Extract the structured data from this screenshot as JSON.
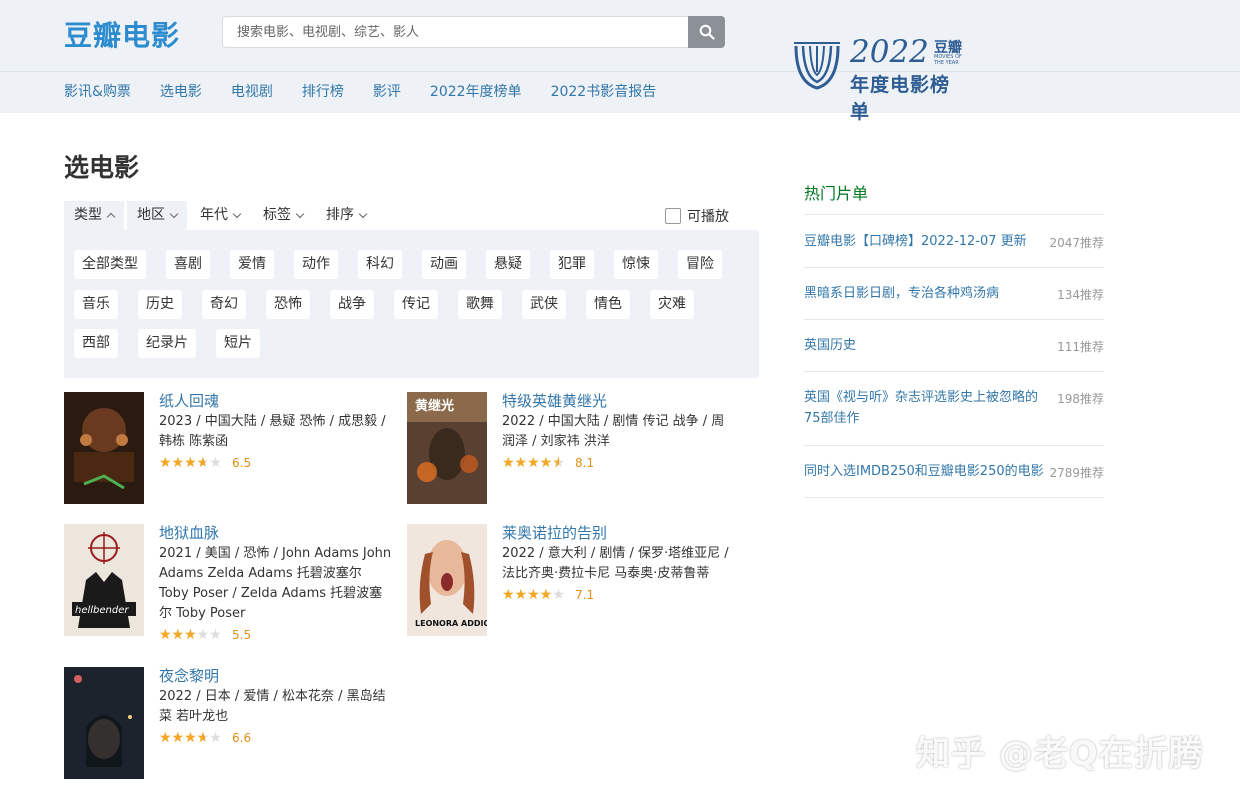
{
  "header": {
    "logo": "豆瓣电影",
    "search_placeholder": "搜索电影、电视剧、综艺、影人",
    "banner": {
      "year": "2022",
      "tag": "豆瓣",
      "sub": "MOVIES OF THE YEAR",
      "title": "年度电影榜单"
    }
  },
  "nav": [
    "影讯&购票",
    "选电影",
    "电视剧",
    "排行榜",
    "影评",
    "2022年度榜单",
    "2022书影音报告"
  ],
  "page_title": "选电影",
  "filters": {
    "items": [
      "类型",
      "地区",
      "年代",
      "标签",
      "排序"
    ],
    "playable": "可播放"
  },
  "tags": [
    "全部类型",
    "喜剧",
    "爱情",
    "动作",
    "科幻",
    "动画",
    "悬疑",
    "犯罪",
    "惊悚",
    "冒险",
    "音乐",
    "历史",
    "奇幻",
    "恐怖",
    "战争",
    "传记",
    "歌舞",
    "武侠",
    "情色",
    "灾难",
    "西部",
    "纪录片",
    "短片"
  ],
  "movies": [
    {
      "title": "纸人回魂",
      "meta": "2023 / 中国大陆 / 悬疑 恐怖 / 成思毅 / 韩栋 陈紫函",
      "rating": "6.5",
      "stars": 0.65,
      "poster_color": "#3a2416"
    },
    {
      "title": "特级英雄黄继光",
      "meta": "2022 / 中国大陆 / 剧情 传记 战争 / 周润泽 / 刘家祎 洪洋",
      "rating": "8.1",
      "stars": 0.81,
      "poster_color": "#6b4a2a"
    },
    {
      "title": "地狱血脉",
      "meta": "2021 / 美国 / 恐怖 / John Adams John Adams Zelda Adams 托碧波塞尔 Toby Poser / Zelda Adams 托碧波塞尔 Toby Poser",
      "rating": "5.5",
      "stars": 0.55,
      "poster_color": "#e8e2d8"
    },
    {
      "title": "莱奥诺拉的告别",
      "meta": "2022 / 意大利 / 剧情 / 保罗·塔维亚尼 / 法比齐奥·费拉卡尼 马泰奥·皮蒂鲁蒂",
      "rating": "7.1",
      "stars": 0.71,
      "poster_color": "#e9d7cc"
    },
    {
      "title": "夜念黎明",
      "meta": "2022 / 日本 / 爱情 / 松本花奈 / 黑岛结菜 若叶龙也",
      "rating": "6.6",
      "stars": 0.66,
      "poster_color": "#1e2630"
    }
  ],
  "sidebar": {
    "title": "热门片单",
    "items": [
      {
        "label": "豆瓣电影【口碑榜】2022-12-07 更新",
        "count": "2047推荐"
      },
      {
        "label": "黑暗系日影日剧，专治各种鸡汤病",
        "count": "134推荐"
      },
      {
        "label": "英国历史",
        "count": "111推荐"
      },
      {
        "label": "英国《视与听》杂志评选影史上被忽略的75部佳作",
        "count": "198推荐"
      },
      {
        "label": "同时入选IMDB250和豆瓣电影250的电影",
        "count": "2789推荐"
      }
    ]
  },
  "watermark": "知乎 @老Q在折腾"
}
